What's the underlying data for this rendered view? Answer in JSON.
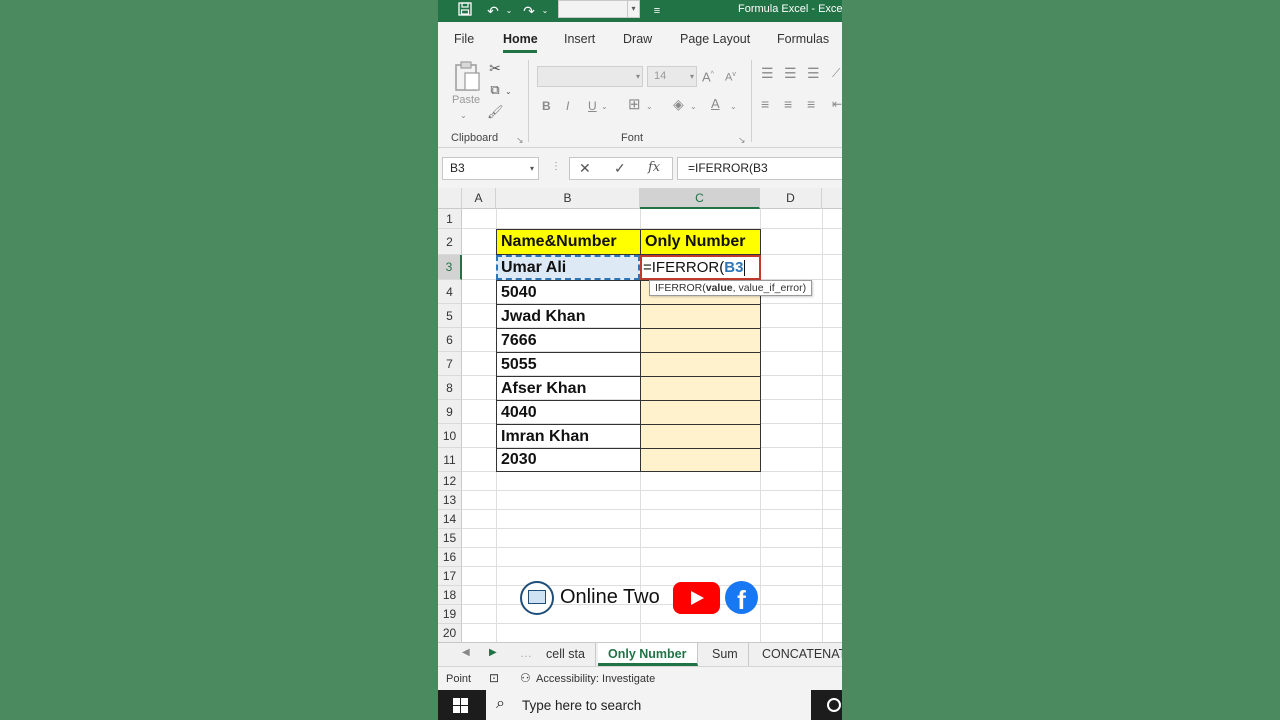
{
  "app": {
    "title": "Formula Excel  -  Excel"
  },
  "menu": {
    "tabs": [
      "File",
      "Home",
      "Insert",
      "Draw",
      "Page Layout",
      "Formulas"
    ],
    "active": "Home"
  },
  "ribbon": {
    "paste_label": "Paste",
    "clipboard_label": "Clipboard",
    "font_label": "Font",
    "font_size": "14",
    "bold": "B",
    "italic": "I",
    "underline": "U"
  },
  "formula_bar": {
    "name_box": "B3",
    "cancel": "✕",
    "enter": "✓",
    "fx": "fx",
    "formula": "=IFERROR(B3"
  },
  "grid": {
    "columns": [
      "A",
      "B",
      "C",
      "D"
    ],
    "rows": [
      "1",
      "2",
      "3",
      "4",
      "5",
      "6",
      "7",
      "8",
      "9",
      "10",
      "11",
      "12",
      "13",
      "14",
      "15",
      "16",
      "17",
      "18",
      "19",
      "20"
    ],
    "header_b": "Name&Number",
    "header_c": "Only Number",
    "b_values": [
      "Umar Ali",
      "5040",
      "Jwad Khan",
      "7666",
      "5055",
      "Afser Khan",
      "4040",
      "Imran Khan",
      "2030"
    ],
    "c3_prefix": "=IFERROR(",
    "c3_ref": "B3",
    "tooltip_fn": "IFERROR(",
    "tooltip_arg1": "value",
    "tooltip_rest": ", value_if_error)"
  },
  "watermark": {
    "text": "Online Two"
  },
  "sheets": {
    "tabs": [
      "cell sta",
      "Only Number",
      "Sum",
      "CONCATENAT"
    ],
    "active": "Only Number"
  },
  "status": {
    "mode": "Point",
    "accessibility": "Accessibility: Investigate"
  },
  "taskbar": {
    "search_placeholder": "Type here to search"
  },
  "colors": {
    "excel_green": "#217346",
    "header_yellow": "#ffff00",
    "column_c_fill": "#fff2cc",
    "edit_border": "#c0392b",
    "ref_blue": "#2e75b6"
  }
}
